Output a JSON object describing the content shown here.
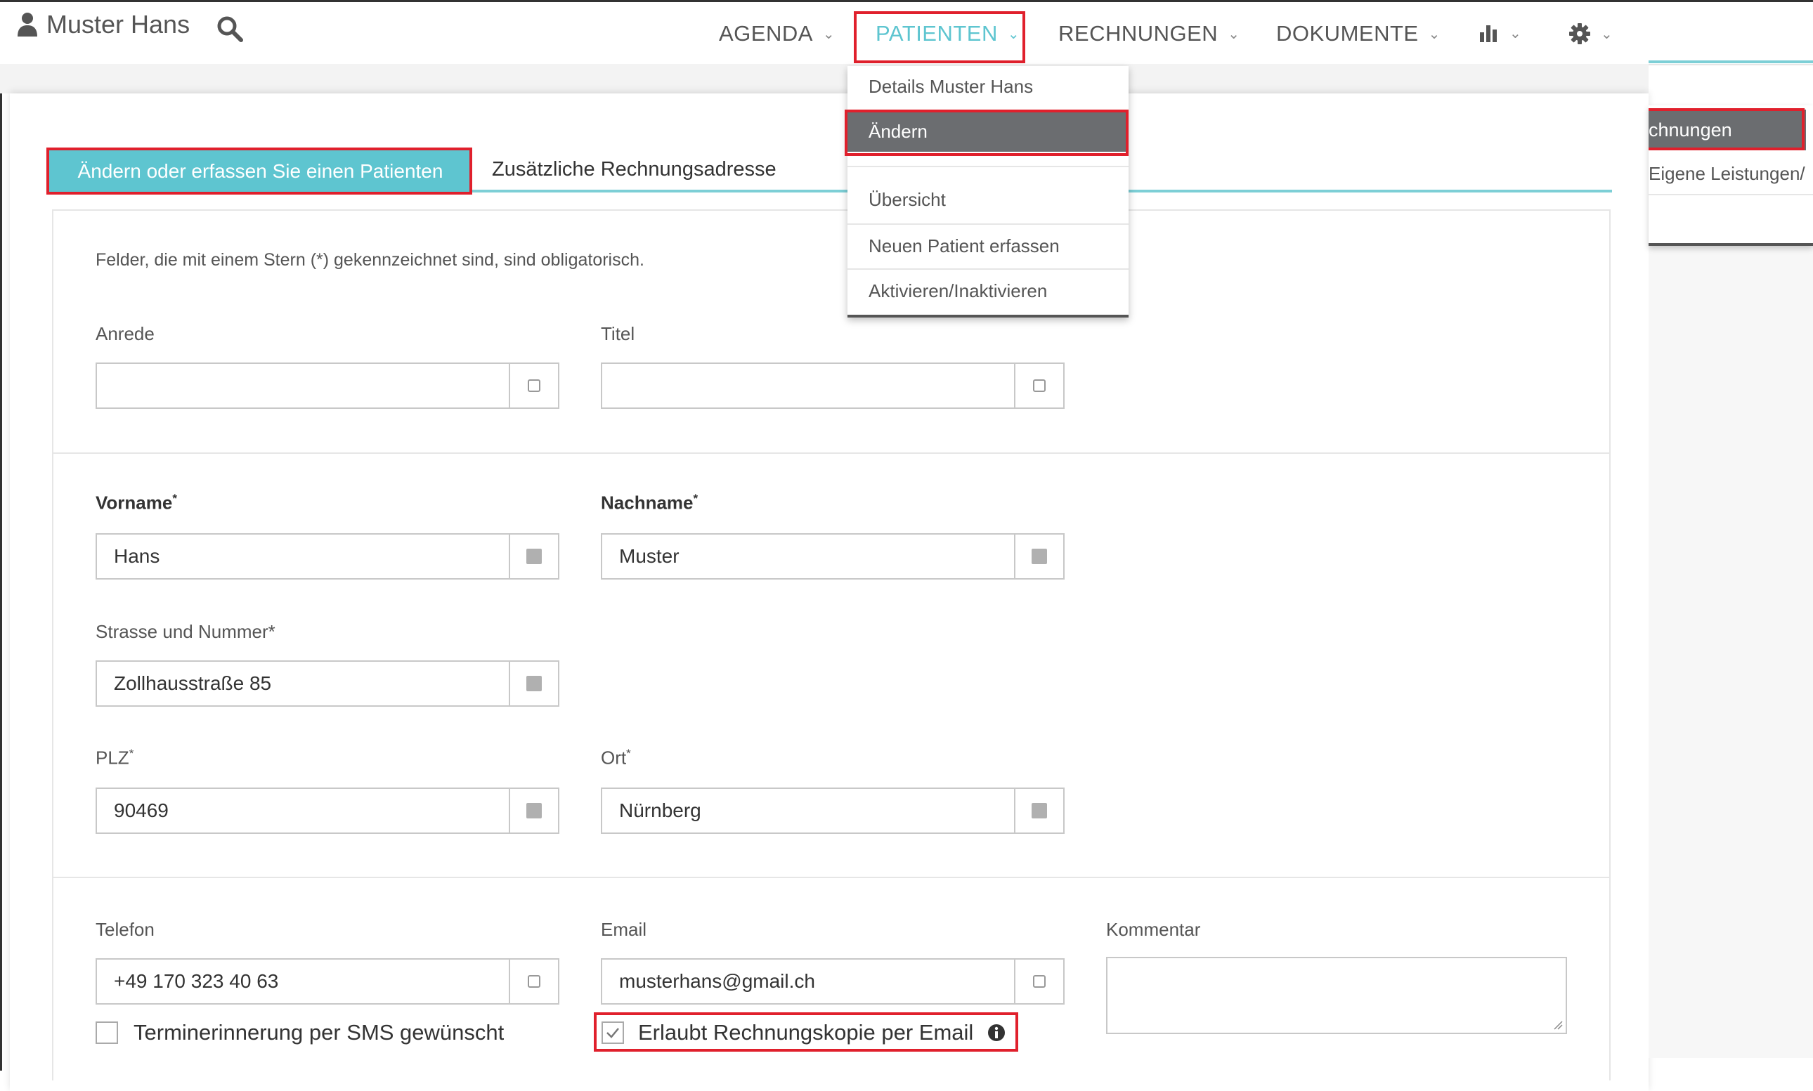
{
  "user": {
    "name": "Muster Hans"
  },
  "nav": {
    "agenda": "AGENDA",
    "patienten": "PATIENTEN",
    "rechnungen": "RECHNUNGEN",
    "dokumente": "DOKUMENTE"
  },
  "icons": {
    "user": "user-icon",
    "search": "search-icon",
    "stats": "bar-chart-icon",
    "settings": "gear-icon",
    "info": "info-icon"
  },
  "dropdown": {
    "items": [
      "Details Muster Hans",
      "Ändern",
      "Übersicht",
      "Neuen Patient erfassen",
      "Aktivieren/Inaktivieren"
    ],
    "active": "Ändern"
  },
  "right_menu": {
    "active": "chnungen",
    "item2": "Eigene Leistungen/"
  },
  "tabs": {
    "active": "Ändern oder erfassen Sie einen Patienten",
    "second": "Zusätzliche Rechnungsadresse"
  },
  "form": {
    "note": "Felder, die mit einem Stern (*) gekennzeichnet sind, sind obligatorisch.",
    "anrede": {
      "label": "Anrede",
      "value": ""
    },
    "titel": {
      "label": "Titel",
      "value": ""
    },
    "vorname": {
      "label": "Vorname",
      "value": "Hans"
    },
    "nachname": {
      "label": "Nachname",
      "value": "Muster"
    },
    "strasse": {
      "label": "Strasse und Nummer*",
      "value": "Zollhausstraße 85"
    },
    "plz": {
      "label": "PLZ",
      "value": "90469"
    },
    "ort": {
      "label": "Ort",
      "value": "Nürnberg"
    },
    "telefon": {
      "label": "Telefon",
      "value": "+49 170 323 40 63"
    },
    "email": {
      "label": "Email",
      "value": "musterhans@gmail.ch"
    },
    "kommentar": {
      "label": "Kommentar",
      "value": ""
    },
    "sms": {
      "label": "Terminerinnerung per SMS gewünscht",
      "checked": false
    },
    "rechnungskopie": {
      "label": "Erlaubt Rechnungskopie per Email",
      "checked": true
    },
    "required_mark": "*"
  },
  "colors": {
    "accent": "#5ec5d0",
    "highlight": "#e0202c",
    "menu_active": "#6b6d70"
  }
}
